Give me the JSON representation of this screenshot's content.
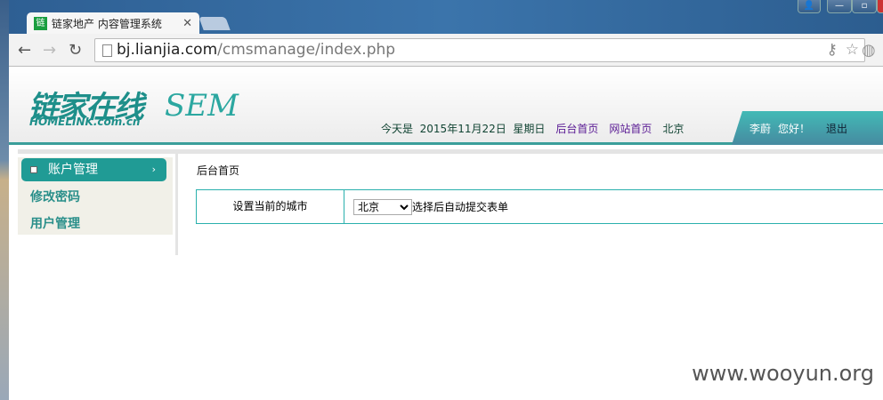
{
  "browser": {
    "tab_title": "链家地产 内容管理系统",
    "favicon": "链",
    "url_host": "bj.lianjia.com",
    "url_path": "/cmsmanage/index.php"
  },
  "header": {
    "logo": "链家在线",
    "logo_sub": "HOMELINK.com.cn",
    "sem": "SEM",
    "today_label": "今天是",
    "date": "2015年11月22日",
    "weekday": "星期日",
    "link_admin_home": "后台首页",
    "link_site_home": "网站首页",
    "city": "北京",
    "user": "李蔚",
    "greeting": "您好！",
    "logout": "退出"
  },
  "sidebar": {
    "group": "账户管理",
    "items": [
      {
        "label": "修改密码"
      },
      {
        "label": "用户管理"
      }
    ]
  },
  "main": {
    "breadcrumb": "后台首页",
    "form_label": "设置当前的城市",
    "city_selected": "北京",
    "hint": "选择后自动提交表单"
  },
  "watermark": "www.wooyun.org",
  "colors": {
    "accent": "#209b95",
    "link": "#5a1b94"
  }
}
